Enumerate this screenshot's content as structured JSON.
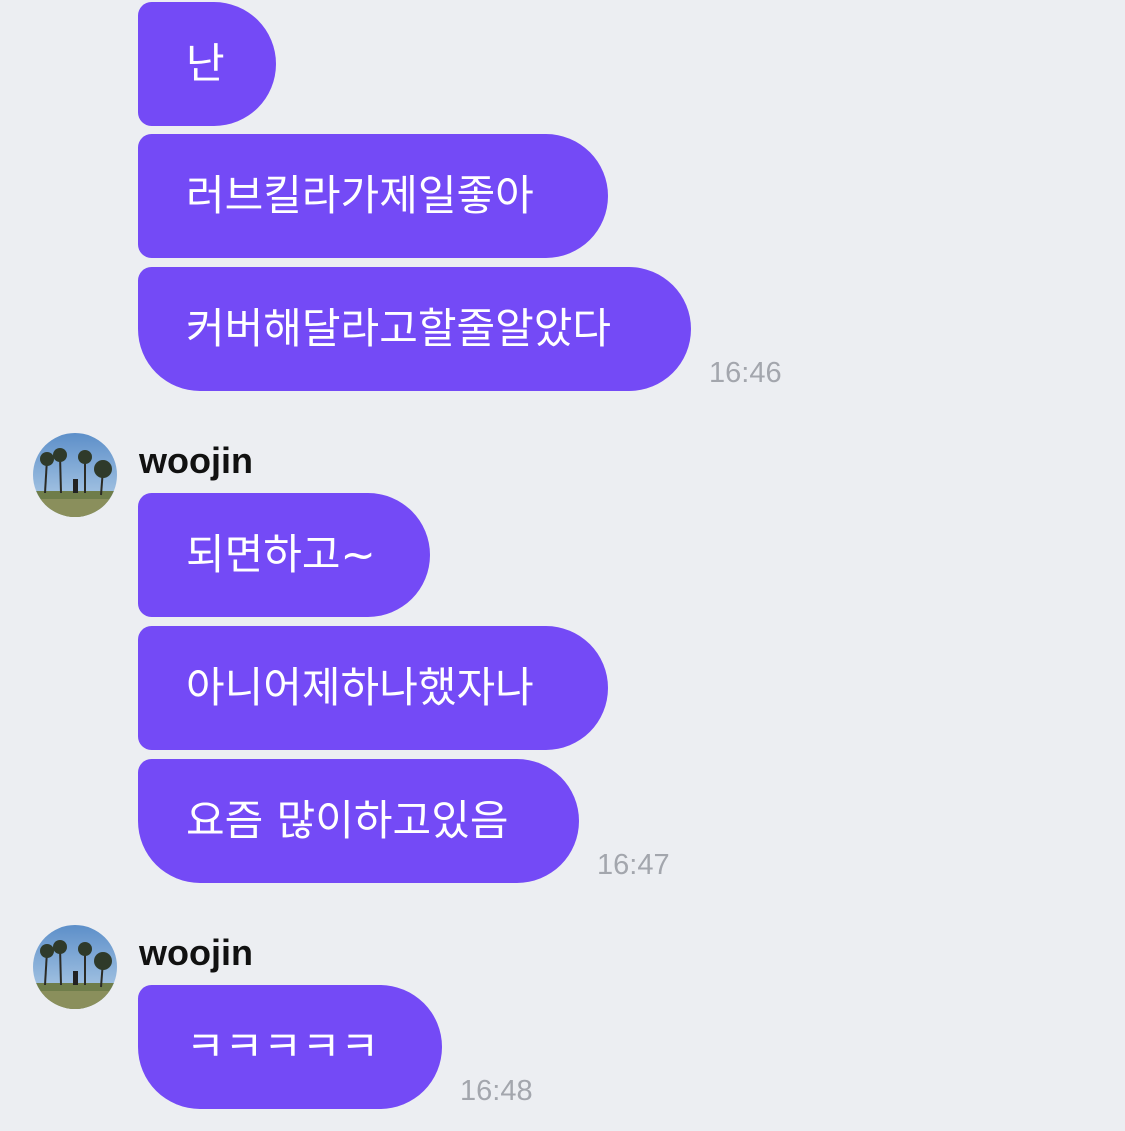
{
  "group1": {
    "messages": [
      "난",
      "러브킬라가제일좋아",
      "커버해달라고할줄알았다"
    ],
    "time": "16:46"
  },
  "group2": {
    "sender": "woojin",
    "messages": [
      "되면하고~",
      "아니어제하나했자나",
      "요즘 많이하고있음"
    ],
    "time": "16:47"
  },
  "group3": {
    "sender": "woojin",
    "messages": [
      "ㅋㅋㅋㅋㅋ"
    ],
    "time": "16:48"
  },
  "colors": {
    "bubble": "#744af6",
    "background": "#eceef2",
    "timestamp": "#a3a6ad"
  },
  "icons": {
    "avatar": "avatar-photo-icon"
  }
}
